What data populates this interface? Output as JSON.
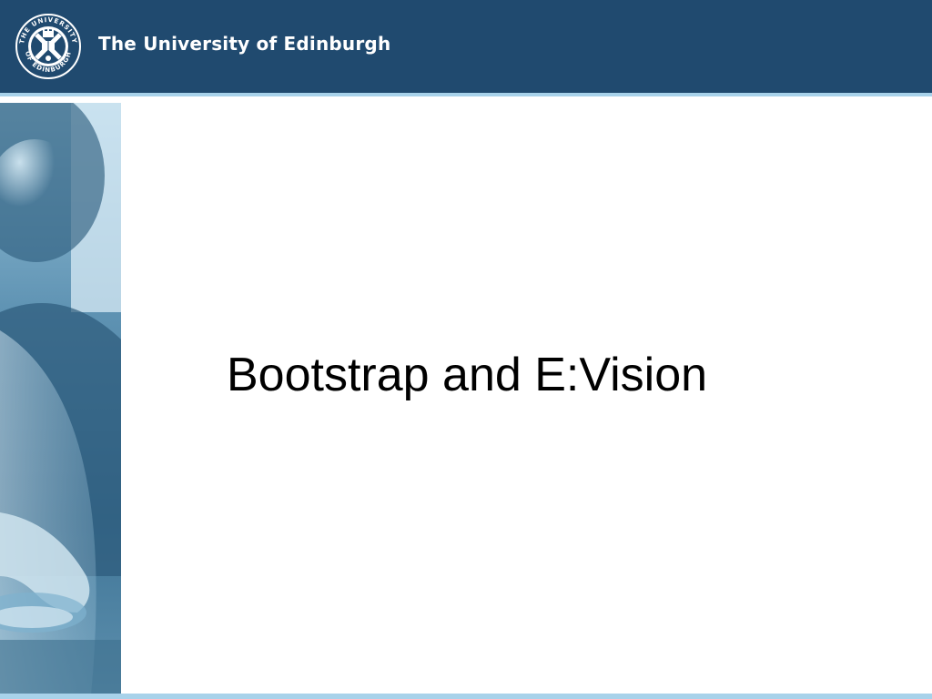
{
  "header": {
    "institution_name": "The University of Edinburgh",
    "crest_text_top": "THE UNIVERSITY",
    "crest_text_bottom": "OF EDINBURGH"
  },
  "slide": {
    "title": "Bootstrap and E:Vision"
  },
  "colors": {
    "header_blue": "#204a6f",
    "accent_light_blue": "#a8d2ea",
    "photo_tint": "#6fa7c7",
    "title_text": "#000000"
  },
  "icons": {
    "crest": "university-crest-icon"
  }
}
